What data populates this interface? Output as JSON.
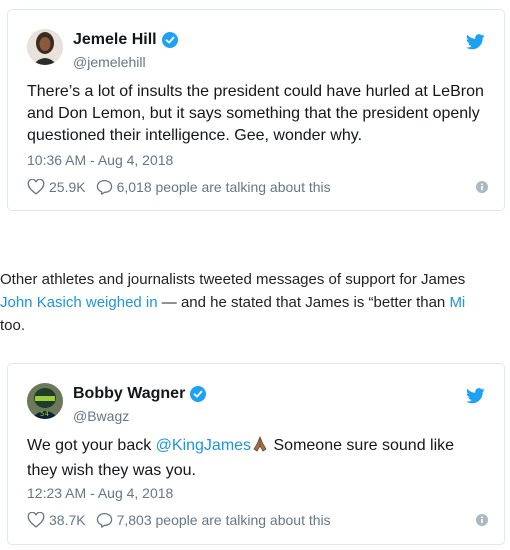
{
  "colors": {
    "link": "#1b95e0",
    "verified": "#1da1f2",
    "muted": "#657786",
    "border": "#e1e8ed"
  },
  "tweets": [
    {
      "name": "Jemele Hill",
      "handle": "@jemelehill",
      "text": "There’s a lot of insults the president could have hurled at LeBron and Don Lemon, but it says something that the president openly questioned their intelligence. Gee, wonder why.",
      "time": "10:36 AM - Aug 4, 2018",
      "likes": "25.9K",
      "talking": "6,018 people are talking about this",
      "icons": [
        "avatar",
        "verified-icon",
        "twitter-bird-icon",
        "heart-icon",
        "comment-icon",
        "info-icon"
      ]
    },
    {
      "name": "Bobby Wagner",
      "handle": "@Bwagz",
      "text_before": "We got your back ",
      "mention": "@KingJames",
      "text_after": " Someone sure sound like they wish they was you.",
      "time": "12:23 AM - Aug 4, 2018",
      "likes": "38.7K",
      "talking": "7,803 people are talking about this",
      "icons": [
        "avatar",
        "verified-icon",
        "twitter-bird-icon",
        "praying-hands-icon",
        "heart-icon",
        "comment-icon",
        "info-icon"
      ]
    }
  ],
  "article": {
    "line1": "Other athletes and journalists tweeted messages of support for James",
    "link1": "John Kasich weighed in",
    "line2_mid": " — and he stated that James is “better than ",
    "link2": "Mi",
    "line3": "too."
  }
}
